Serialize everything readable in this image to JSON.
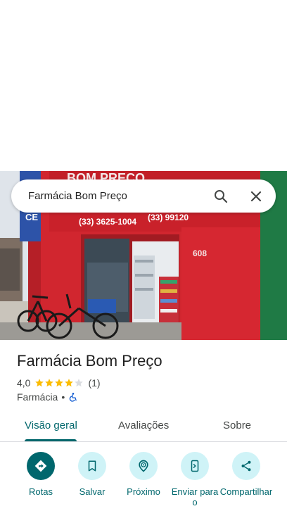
{
  "search": {
    "query": "Farmácia Bom Preço"
  },
  "photo": {
    "sign_phone": "(33) 3625-1004",
    "sign_whatsapp": "(33) 99120",
    "sign_name_top": "BOM PREÇO",
    "sign_letters": "CE",
    "house_number": "608"
  },
  "place": {
    "title": "Farmácia Bom Preço",
    "rating": "4,0",
    "stars_filled": 4,
    "stars_total": 5,
    "review_count": "(1)",
    "category": "Farmácia",
    "separator": "•"
  },
  "tabs": [
    {
      "label": "Visão geral",
      "active": true
    },
    {
      "label": "Avaliações",
      "active": false
    },
    {
      "label": "Sobre",
      "active": false
    }
  ],
  "actions": [
    {
      "label": "Rotas",
      "icon": "directions-icon"
    },
    {
      "label": "Salvar",
      "icon": "bookmark-icon"
    },
    {
      "label": "Próximo",
      "icon": "nearby-icon"
    },
    {
      "label": "Enviar para o",
      "icon": "send-to-phone-icon"
    },
    {
      "label": "Compartilhar",
      "icon": "share-icon"
    }
  ],
  "colors": {
    "accent": "#00676d",
    "accent_light": "#cff3f7",
    "star": "#fbbc04",
    "star_empty": "#dadce0"
  }
}
